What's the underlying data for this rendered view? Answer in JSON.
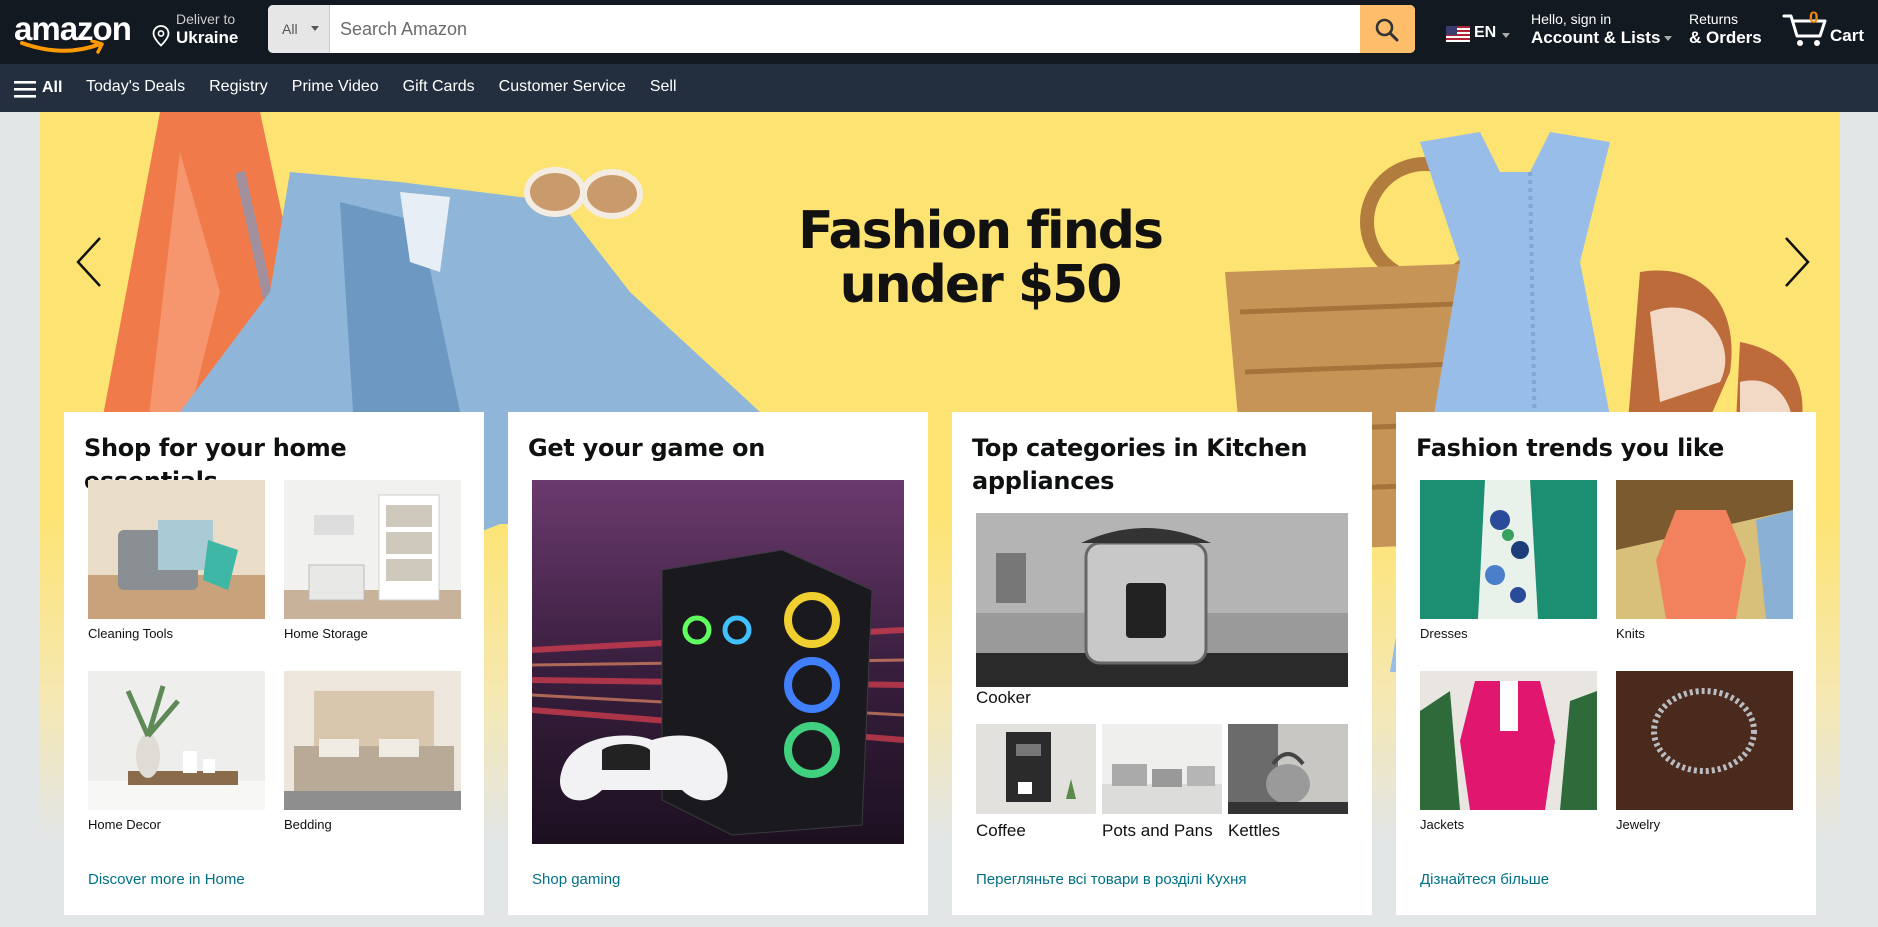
{
  "header": {
    "logo_text": "amazon",
    "deliver_label": "Deliver to",
    "deliver_location": "Ukraine",
    "search": {
      "category": "All",
      "placeholder": "Search Amazon"
    },
    "language": "EN",
    "account_greeting": "Hello, sign in",
    "account_label": "Account & Lists",
    "returns_label": "Returns",
    "orders_label": "& Orders",
    "cart_count": "0",
    "cart_label": "Cart"
  },
  "subnav": {
    "all_label": "All",
    "links": [
      "Today's Deals",
      "Registry",
      "Prime Video",
      "Gift Cards",
      "Customer Service",
      "Sell"
    ]
  },
  "hero": {
    "title_line1": "Fashion finds",
    "title_line2": "under $50"
  },
  "cards": {
    "home": {
      "title": "Shop for your home essentials",
      "items": [
        "Cleaning Tools",
        "Home Storage",
        "Home Decor",
        "Bedding"
      ],
      "link": "Discover more in Home"
    },
    "game": {
      "title": "Get your game on",
      "link": "Shop gaming"
    },
    "kitchen": {
      "title": "Top categories in Kitchen appliances",
      "main_item": "Cooker",
      "items": [
        "Coffee",
        "Pots and Pans",
        "Kettles"
      ],
      "link": "Перегляньте всі товари в розділі Кухня"
    },
    "fashion": {
      "title": "Fashion trends you like",
      "items": [
        "Dresses",
        "Knits",
        "Jackets",
        "Jewelry"
      ],
      "link": "Дізнайтеся більше"
    }
  },
  "colors": {
    "nav_dark": "#131921",
    "nav_sub": "#232f3e",
    "accent": "#febd69",
    "link": "#007185",
    "hero_bg": "#fde472"
  }
}
